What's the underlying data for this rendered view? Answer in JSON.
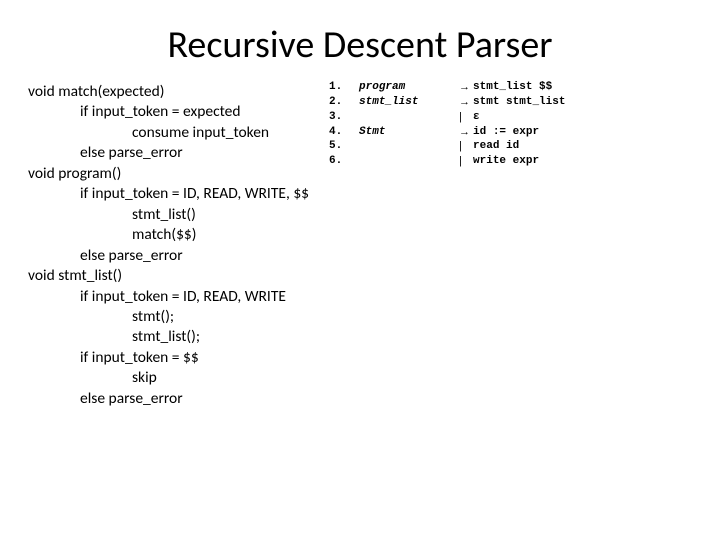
{
  "title": "Recursive Descent Parser",
  "pseudo": {
    "match": {
      "sig": "void match(expected)",
      "if": "if input_token = expected",
      "consume": "consume input_token",
      "else": "else parse_error"
    },
    "program": {
      "sig": "void program()",
      "if": "if input_token = ID, READ, WRITE, $$",
      "call1": "stmt_list()",
      "call2": "match($$)",
      "else": "else parse_error"
    },
    "stmt_list": {
      "sig": "void stmt_list()",
      "if": "if input_token = ID, READ, WRITE",
      "call1": "stmt();",
      "call2": "stmt_list();",
      "if2": "if input_token = $$",
      "skip": "skip",
      "else": "else parse_error"
    }
  },
  "grammar": [
    {
      "n": "1.",
      "head": "program",
      "arrow": "→",
      "body": "stmt_list $$"
    },
    {
      "n": "2.",
      "head": "stmt_list",
      "arrow": "→",
      "body": "stmt stmt_list"
    },
    {
      "n": "3.",
      "head": "",
      "arrow": "|",
      "body": "ε"
    },
    {
      "n": "4.",
      "head": "Stmt",
      "arrow": "→",
      "body": "id := expr"
    },
    {
      "n": "5.",
      "head": "",
      "arrow": "|",
      "body": "read id"
    },
    {
      "n": "6.",
      "head": "",
      "arrow": "|",
      "body": "write expr"
    }
  ]
}
